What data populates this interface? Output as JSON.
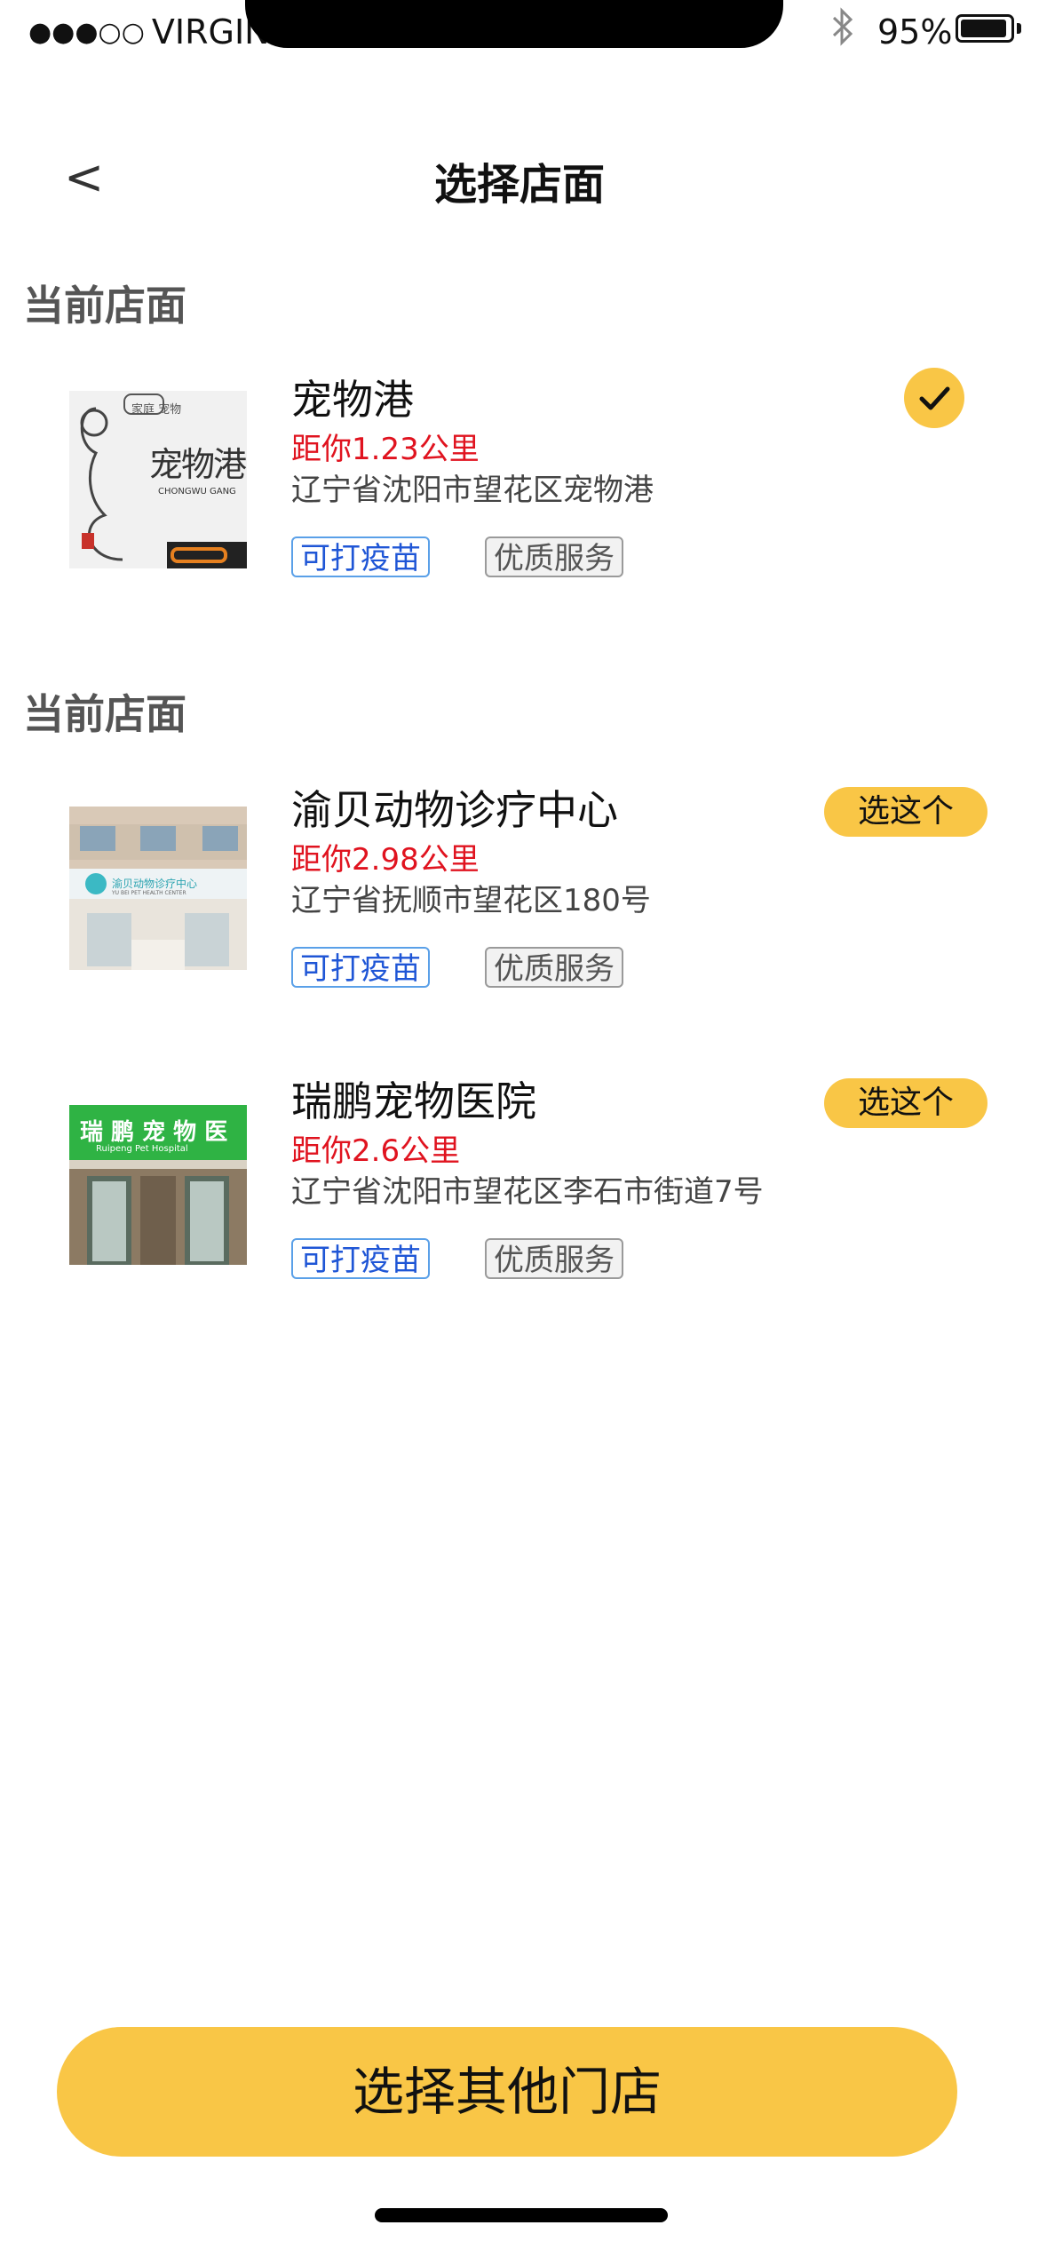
{
  "status_bar": {
    "signal_dots": "●●●○○",
    "carrier": "VIRGIN",
    "bluetooth_icon": "bluetooth-icon",
    "battery_percent": "95%",
    "battery_level": 0.95
  },
  "header": {
    "back_label": "<",
    "title": "选择店面"
  },
  "sections": [
    {
      "title": "当前店面"
    },
    {
      "title": "当前店面"
    }
  ],
  "stores": [
    {
      "name": "宠物港",
      "distance": "距你1.23公里",
      "address": "辽宁省沈阳市望花区宠物港",
      "tags": [
        "可打疫苗",
        "优质服务"
      ],
      "selected": true,
      "action_label": "",
      "thumb_text": "宠物港",
      "thumb_subtext": "CHONGWU GANG",
      "thumb_badge": "家庭 宠物"
    },
    {
      "name": "渝贝动物诊疗中心",
      "distance": "距你2.98公里",
      "address": "辽宁省抚顺市望花区180号",
      "tags": [
        "可打疫苗",
        "优质服务"
      ],
      "selected": false,
      "action_label": "选这个",
      "thumb_text": "渝贝动物诊疗中心",
      "thumb_subtext": "YU BEI PET HEALTH CENTER"
    },
    {
      "name": "瑞鹏宠物医院",
      "distance": "距你2.6公里",
      "address": "辽宁省沈阳市望花区李石市街道7号",
      "tags": [
        "可打疫苗",
        "优质服务"
      ],
      "selected": false,
      "action_label": "选这个",
      "thumb_text": "瑞 鹏 宠 物 医",
      "thumb_subtext": "Ruipeng Pet Hospital"
    }
  ],
  "bottom_button": {
    "label": "选择其他门店"
  },
  "colors": {
    "accent": "#f9c646",
    "distance": "#e0131f",
    "tag_blue": "#1f56d6"
  }
}
